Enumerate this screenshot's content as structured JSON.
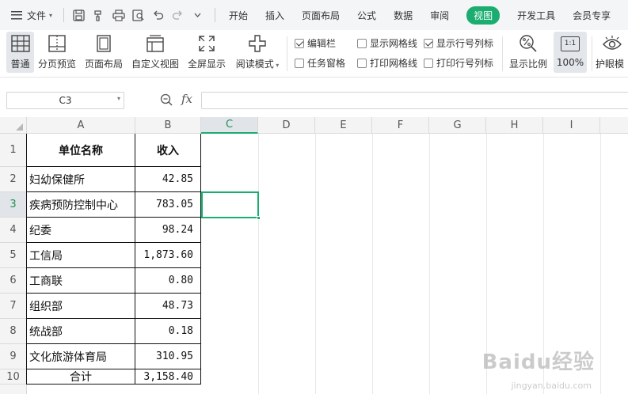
{
  "menubar": {
    "file_label": "文件",
    "quick_access_icons": [
      "save-icon",
      "format-painter-icon",
      "print-icon",
      "print-preview-icon",
      "undo-icon",
      "redo-icon",
      "customize-icon"
    ],
    "tabs": [
      {
        "label": "开始",
        "active": false
      },
      {
        "label": "插入",
        "active": false
      },
      {
        "label": "页面布局",
        "active": false
      },
      {
        "label": "公式",
        "active": false
      },
      {
        "label": "数据",
        "active": false
      },
      {
        "label": "审阅",
        "active": false
      },
      {
        "label": "视图",
        "active": true
      },
      {
        "label": "开发工具",
        "active": false
      },
      {
        "label": "会员专享",
        "active": false
      }
    ]
  },
  "ribbon": {
    "buttons": {
      "normal": "普通",
      "page_break_preview": "分页预览",
      "page_layout": "页面布局",
      "custom_view": "自定义视图",
      "full_screen": "全屏显示",
      "reading_mode": "阅读模式",
      "display_ratio": "显示比例",
      "zoom_100": "100%",
      "zoom_100_icon_text": "1:1",
      "eye_protection": "护眼模"
    },
    "checkboxes": {
      "formula_bar": {
        "label": "编辑栏",
        "checked": true
      },
      "task_pane": {
        "label": "任务窗格",
        "checked": false
      },
      "show_gridlines": {
        "label": "显示网格线",
        "checked": false
      },
      "print_gridlines": {
        "label": "打印网格线",
        "checked": false
      },
      "show_headings": {
        "label": "显示行号列标",
        "checked": true
      },
      "print_headings": {
        "label": "打印行号列标",
        "checked": false
      }
    }
  },
  "formula_bar": {
    "name_box": "C3",
    "fx_label": "fx",
    "formula": ""
  },
  "sheet": {
    "columns": [
      "A",
      "B",
      "C",
      "D",
      "E",
      "F",
      "G",
      "H",
      "I"
    ],
    "active_column": "C",
    "active_row": 3,
    "rows": [
      "1",
      "2",
      "3",
      "4",
      "5",
      "6",
      "7",
      "8",
      "9",
      "10"
    ],
    "header": {
      "name": "单位名称",
      "income": "收入"
    },
    "data": [
      {
        "name": "妇幼保健所",
        "income": "42.85"
      },
      {
        "name": "疾病预防控制中心",
        "income": "783.05"
      },
      {
        "name": "纪委",
        "income": "98.24"
      },
      {
        "name": "工信局",
        "income": "1,873.60"
      },
      {
        "name": "工商联",
        "income": "0.80"
      },
      {
        "name": "组织部",
        "income": "48.73"
      },
      {
        "name": "统战部",
        "income": "0.18"
      },
      {
        "name": "文化旅游体育局",
        "income": "310.95"
      }
    ],
    "total": {
      "name": "合计",
      "income": "3,158.40"
    }
  },
  "watermark": {
    "text": "Baidu经验",
    "sub": "jingyan.baidu.com"
  }
}
